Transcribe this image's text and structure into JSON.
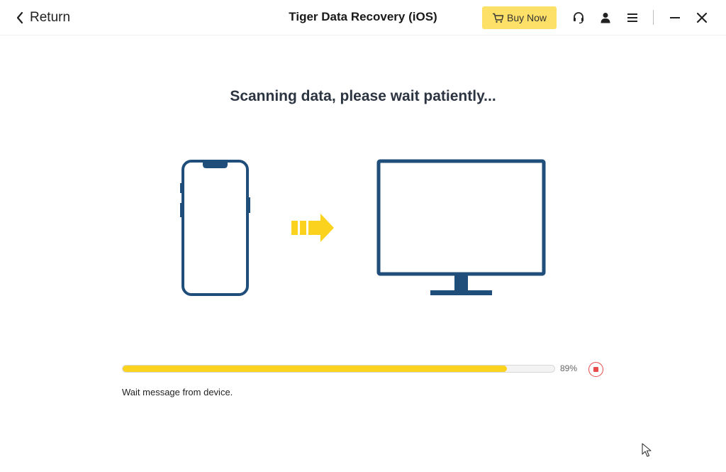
{
  "window": {
    "return_label": "Return",
    "app_title": "Tiger Data Recovery (iOS)",
    "buy_now_label": "Buy Now",
    "icons": [
      "chevron-left-icon",
      "cart-icon",
      "headset-icon",
      "user-icon",
      "menu-icon",
      "minimize-icon",
      "close-icon"
    ]
  },
  "main": {
    "heading": "Scanning data, please wait patiently..."
  },
  "progress": {
    "percent": 89,
    "percent_label": "89%",
    "status_message": "Wait message from device."
  },
  "colors": {
    "accent_yellow": "#fbd21e",
    "buy_button": "#fde068",
    "device_blue": "#1f4e7a",
    "stop_red": "#e84b4b"
  }
}
